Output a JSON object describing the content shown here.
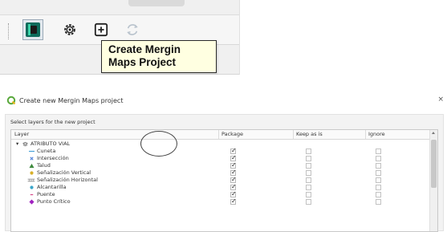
{
  "toolbar": {
    "tooltip": "Create Mergin Maps Project",
    "buttons": [
      {
        "icon": "mergin-map-icon",
        "selected": true
      },
      {
        "icon": "gear-icon",
        "selected": false
      },
      {
        "icon": "plus-icon",
        "selected": false
      },
      {
        "icon": "sync-icon",
        "selected": false
      }
    ]
  },
  "dialog": {
    "title": "Create new Mergin Maps project",
    "close": "×",
    "section_label": "Select layers for the new project",
    "columns": [
      "Layer",
      "Package",
      "Keep as is",
      "Ignore"
    ],
    "group": {
      "expander": "▾",
      "name": "ATRIBUTO VIAL"
    },
    "layers": [
      {
        "name": "Cuneta",
        "icon": "line-icon",
        "color": "#4aa3d8",
        "package": true,
        "keep": false,
        "ignore": false
      },
      {
        "name": "Intersección",
        "icon": "cross-icon",
        "color": "#4a7dd8",
        "package": true,
        "keep": false,
        "ignore": false
      },
      {
        "name": "Talud",
        "icon": "triangle-icon",
        "color": "#3d8a3d",
        "package": true,
        "keep": false,
        "ignore": false
      },
      {
        "name": "Señalización Vertical",
        "icon": "dot-icon",
        "color": "#d8b02a",
        "package": true,
        "keep": false,
        "ignore": false
      },
      {
        "name": "Señalización Horizontal",
        "icon": "hatch-line-icon",
        "color": "#888888",
        "package": true,
        "keep": false,
        "ignore": false
      },
      {
        "name": "Alcantarilla",
        "icon": "dot-icon",
        "color": "#3aa6c9",
        "package": true,
        "keep": false,
        "ignore": false
      },
      {
        "name": "Puente",
        "icon": "dash-icon",
        "color": "#d84a8a",
        "package": true,
        "keep": false,
        "ignore": false
      },
      {
        "name": "Punto Crítico",
        "icon": "diamond-icon",
        "color": "#a020c0",
        "package": true,
        "keep": false,
        "ignore": false
      }
    ]
  }
}
